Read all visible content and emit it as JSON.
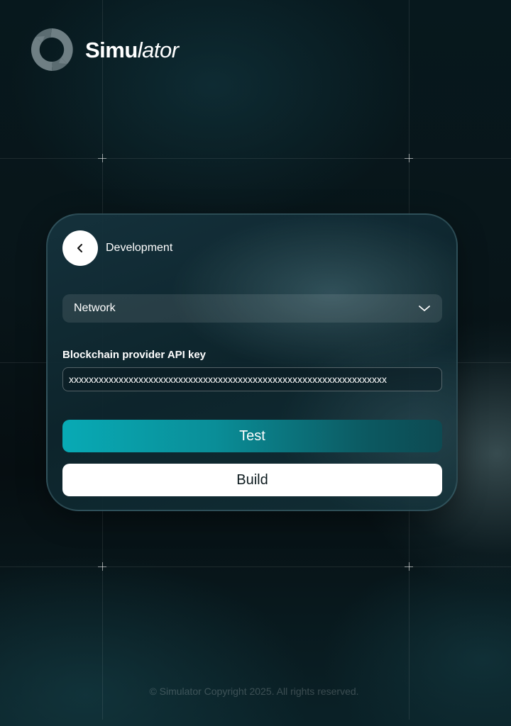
{
  "brand": {
    "name_bold": "Simu",
    "name_italic": "lator",
    "logo_icon": "circular-arrows-icon"
  },
  "card": {
    "title": "Development",
    "back_icon": "chevron-left-icon",
    "network_select": {
      "value": "Network",
      "icon": "chevron-down-icon"
    },
    "api_key": {
      "label": "Blockchain provider API key",
      "value": "xxxxxxxxxxxxxxxxxxxxxxxxxxxxxxxxxxxxxxxxxxxxxxxxxxxxxxxxxxxxxxxx"
    },
    "test_button": "Test",
    "build_button": "Build"
  },
  "footer": {
    "copyright": "© Simulator Copyright 2025. All rights reserved."
  },
  "colors": {
    "background": "#07181d",
    "accent": "#08aab5",
    "card_border": "#4f7a84",
    "button_light": "#ffffff"
  }
}
